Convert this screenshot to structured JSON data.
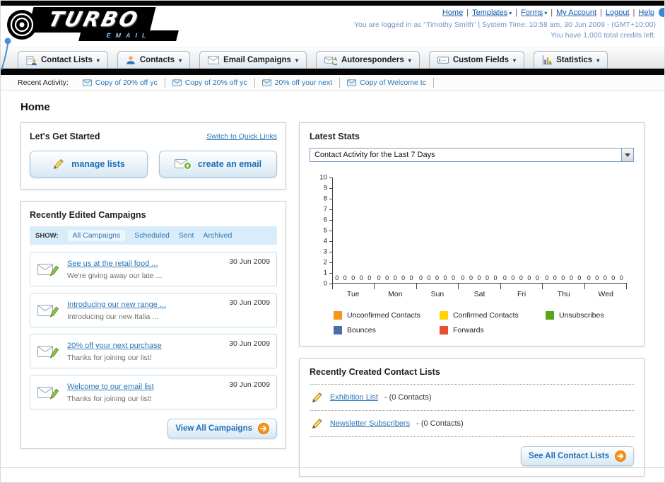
{
  "header": {
    "logo": {
      "title": "TURBO",
      "subtitle": "EMAIL"
    },
    "separator": "|",
    "nav_links": [
      {
        "label": "Home",
        "dropdown": false
      },
      {
        "label": "Templates",
        "dropdown": true
      },
      {
        "label": "Forms",
        "dropdown": true
      },
      {
        "label": "My Account",
        "dropdown": false
      },
      {
        "label": "Logout",
        "dropdown": false
      },
      {
        "label": "Help",
        "dropdown": false
      }
    ],
    "login_info": "You are logged in as \"Timothy Smith\" | System Time: 10:58 am, 30 Jun 2009 - (GMT+10:00)",
    "credits_info": "You have 1,000 total credits left."
  },
  "main_nav": {
    "tabs": [
      {
        "label": "Contact Lists",
        "icon": "contact-lists-icon"
      },
      {
        "label": "Contacts",
        "icon": "contacts-icon"
      },
      {
        "label": "Email Campaigns",
        "icon": "email-campaigns-icon"
      },
      {
        "label": "Autoresponders",
        "icon": "autoresponders-icon"
      },
      {
        "label": "Custom Fields",
        "icon": "custom-fields-icon"
      },
      {
        "label": "Statistics",
        "icon": "statistics-icon"
      }
    ]
  },
  "recent_activity": {
    "label": "Recent Activity:",
    "items": [
      {
        "label": "Copy of 20% off yc",
        "icon": "email-icon"
      },
      {
        "label": "Copy of 20% off yc",
        "icon": "email-icon"
      },
      {
        "label": "20% off your next",
        "icon": "email-icon"
      },
      {
        "label": "Copy of Welcome tc",
        "icon": "email-icon"
      }
    ]
  },
  "page": {
    "title": "Home"
  },
  "get_started": {
    "title": "Let's Get Started",
    "switch_link": "Switch to Quick Links",
    "manage_lists_label": "manage lists",
    "create_email_label": "create an email"
  },
  "campaigns": {
    "title": "Recently Edited Campaigns",
    "show_label": "SHOW:",
    "filters": [
      {
        "label": "All Campaigns",
        "selected": true
      },
      {
        "label": "Scheduled",
        "selected": false
      },
      {
        "label": "Sent",
        "selected": false
      },
      {
        "label": "Archived",
        "selected": false
      }
    ],
    "items": [
      {
        "title": "See us at the retail food ...",
        "subtitle": "We're giving away our late ...",
        "date": "30 Jun 2009"
      },
      {
        "title": "Introducing our new range ...",
        "subtitle": "Introducing our new Italia ...",
        "date": "30 Jun 2009"
      },
      {
        "title": "20% off your next purchase",
        "subtitle": "Thanks for joining our list!",
        "date": "30 Jun 2009"
      },
      {
        "title": "Welcome to our email list",
        "subtitle": "Thanks for joining our list!",
        "date": "30 Jun 2009"
      }
    ],
    "view_all_label": "View All Campaigns"
  },
  "stats": {
    "title": "Latest Stats",
    "period_selected": "Contact Activity for the Last 7 Days",
    "chart_data": {
      "type": "bar",
      "title": "Contact Activity for the Last 7 Days",
      "categories": [
        "Tue",
        "Mon",
        "Sun",
        "Sat",
        "Fri",
        "Thu",
        "Wed"
      ],
      "series": [
        {
          "name": "Unconfirmed Contacts",
          "color": "#f7941d",
          "values": [
            0,
            0,
            0,
            0,
            0,
            0,
            0
          ]
        },
        {
          "name": "Confirmed Contacts",
          "color": "#ffd400",
          "values": [
            0,
            0,
            0,
            0,
            0,
            0,
            0
          ]
        },
        {
          "name": "Unsubscribes",
          "color": "#58a618",
          "values": [
            0,
            0,
            0,
            0,
            0,
            0,
            0
          ]
        },
        {
          "name": "Bounces",
          "color": "#4a6fa5",
          "values": [
            0,
            0,
            0,
            0,
            0,
            0,
            0
          ]
        },
        {
          "name": "Forwards",
          "color": "#e8502d",
          "values": [
            0,
            0,
            0,
            0,
            0,
            0,
            0
          ]
        }
      ],
      "ylim": [
        0,
        10
      ],
      "y_tick_step": 1,
      "show_value_labels": true,
      "grid": false,
      "legend_position": "bottom"
    }
  },
  "contact_lists": {
    "title": "Recently Created Contact Lists",
    "items": [
      {
        "name": "Exhibition List",
        "detail": "- (0 Contacts)"
      },
      {
        "name": "Newsletter Subscribers",
        "detail": "- (0 Contacts)"
      }
    ],
    "see_all_label": "See All Contact Lists"
  }
}
